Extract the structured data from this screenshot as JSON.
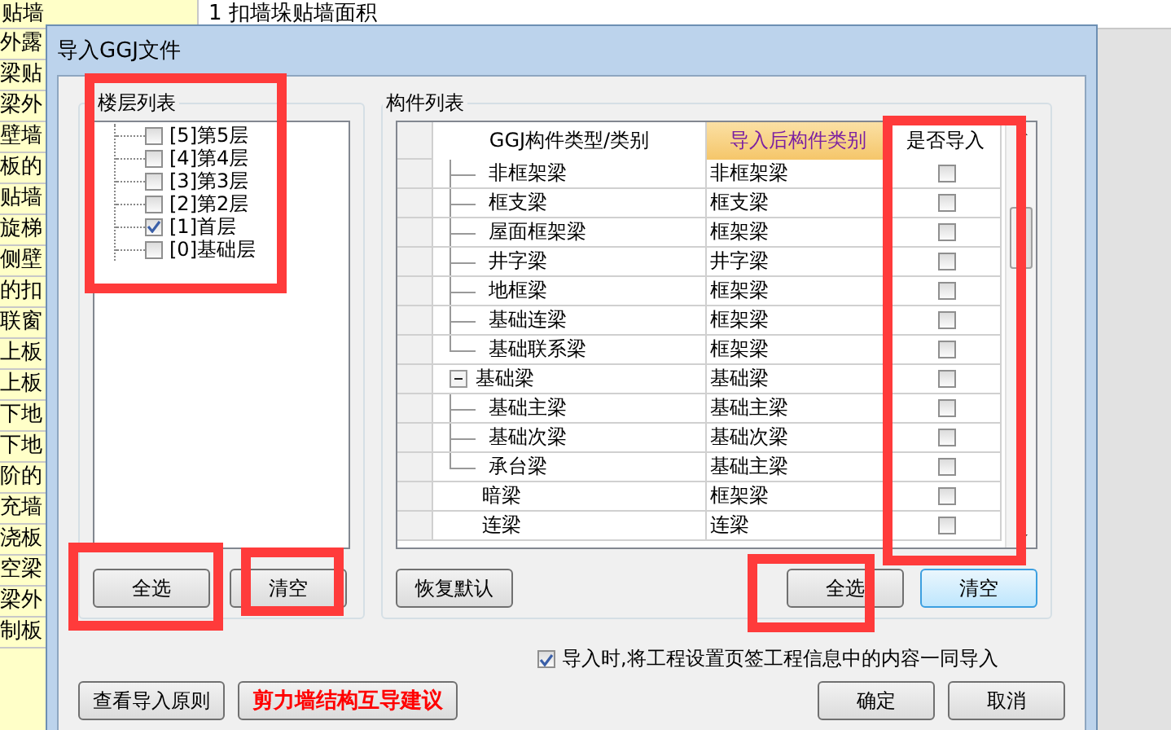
{
  "background_sheet": {
    "header_cells": [
      "贴墙",
      "1 扣墙垛贴墙面积"
    ],
    "column_cells": [
      "外露",
      "梁贴",
      "梁外",
      "壁墙",
      "板的",
      "贴墙",
      "旋梯",
      "侧壁",
      "的扣",
      "联窗",
      "上板",
      "上板",
      "下地",
      "下地",
      "阶的",
      "充墙",
      "浇板",
      "空梁",
      "梁外",
      "制板"
    ]
  },
  "dialog": {
    "title": "导入GGJ文件",
    "floor_panel": {
      "title": "楼层列表",
      "floors": [
        {
          "label": "[5]第5层",
          "checked": false
        },
        {
          "label": "[4]第4层",
          "checked": false
        },
        {
          "label": "[3]第3层",
          "checked": false
        },
        {
          "label": "[2]第2层",
          "checked": false
        },
        {
          "label": "[1]首层",
          "checked": true
        },
        {
          "label": "[0]基础层",
          "checked": false
        }
      ],
      "buttons": [
        {
          "label": "全选",
          "focused": false
        },
        {
          "label": "清空",
          "focused": false
        }
      ]
    },
    "component_panel": {
      "title": "构件列表",
      "columns": [
        "GGJ构件类型/类别",
        "导入后构件类别",
        "是否导入"
      ],
      "rows": [
        {
          "kind": "branch",
          "name": "非框架梁",
          "target": "非框架梁",
          "checked": false
        },
        {
          "kind": "branch",
          "name": "框支梁",
          "target": "框支梁",
          "checked": false
        },
        {
          "kind": "branch",
          "name": "屋面框架梁",
          "target": "框架梁",
          "checked": false
        },
        {
          "kind": "branch",
          "name": "井字梁",
          "target": "井字梁",
          "checked": false
        },
        {
          "kind": "branch",
          "name": "地框梁",
          "target": "框架梁",
          "checked": false
        },
        {
          "kind": "branch",
          "name": "基础连梁",
          "target": "框架梁",
          "checked": false
        },
        {
          "kind": "last",
          "name": "基础联系梁",
          "target": "框架梁",
          "checked": false
        },
        {
          "kind": "group",
          "name": "基础梁",
          "target": "基础梁",
          "checked": false,
          "expanded": true
        },
        {
          "kind": "branch",
          "name": "基础主梁",
          "target": "基础主梁",
          "checked": false
        },
        {
          "kind": "branch",
          "name": "基础次梁",
          "target": "基础次梁",
          "checked": false
        },
        {
          "kind": "last",
          "name": "承台梁",
          "target": "基础主梁",
          "checked": false
        },
        {
          "kind": "item",
          "name": "暗梁",
          "target": "框架梁",
          "checked": false
        },
        {
          "kind": "item",
          "name": "连梁",
          "target": "连梁",
          "checked": false
        }
      ],
      "buttons": [
        {
          "label": "恢复默认",
          "focused": false
        },
        {
          "label": "全选",
          "focused": false
        },
        {
          "label": "清空",
          "focused": true
        }
      ]
    },
    "import_option": {
      "label": "导入时,将工程设置页签工程信息中的内容一同导入",
      "checked": true
    },
    "footer_buttons": [
      {
        "label": "查看导入原则",
        "kind": "normal"
      },
      {
        "label": "剪力墙结构互导建议",
        "kind": "alert"
      },
      {
        "label": "确定",
        "kind": "normal"
      },
      {
        "label": "取消",
        "kind": "normal"
      }
    ]
  }
}
